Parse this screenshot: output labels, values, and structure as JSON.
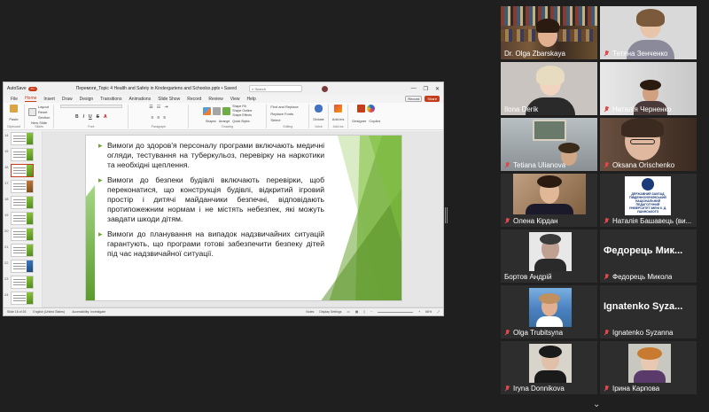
{
  "powerpoint": {
    "autosave_label": "AutoSave",
    "autosave_state": "On",
    "doc_title": "Перемоги_Topic 4 Health and Safety in Kindergartens and Schoolsх.pptx • Saved",
    "search_placeholder": "Search",
    "window_buttons": [
      "—",
      "❐",
      "✕"
    ],
    "menu": [
      "File",
      "Home",
      "Insert",
      "Draw",
      "Design",
      "Transitions",
      "Animations",
      "Slide Show",
      "Record",
      "Review",
      "View",
      "Help"
    ],
    "active_menu": "Home",
    "record_label": "Record",
    "share_label": "Share",
    "ribbon_groups": [
      {
        "name": "Clipboard",
        "label": "Paste"
      },
      {
        "name": "Slides",
        "label": "New Slide"
      },
      {
        "name": "Font",
        "label": ""
      },
      {
        "name": "Paragraph",
        "label": ""
      },
      {
        "name": "Drawing",
        "label": "Shapes"
      },
      {
        "name": "Editing",
        "label": "Find and Replace"
      },
      {
        "name": "Voice",
        "label": "Dictate"
      },
      {
        "name": "Add-ins",
        "label": "Add-ins"
      },
      {
        "name": "",
        "label": "Designer"
      },
      {
        "name": "",
        "label": "Copilot"
      }
    ],
    "ribbon_small": {
      "layout": "Layout",
      "reset": "Reset",
      "section": "Section",
      "replace": "Replace Fonts",
      "select": "Select",
      "shape_fill": "Shape Fill",
      "shape_outline": "Shape Outline",
      "shape_effects": "Shape Effects",
      "arrange": "Arrange",
      "quick_styles": "Quick Styles"
    },
    "thumb_numbers": [
      "14",
      "15",
      "16",
      "17",
      "18",
      "19",
      "20",
      "21",
      "22",
      "23",
      "24"
    ],
    "slide_bullets": [
      "Вимоги до здоров'я персоналу програми включають медичні огляди, тестування на туберкульоз, перевірку на наркотики та необхідні щеплення.",
      "Вимоги до безпеки будівлі включають перевірки, щоб переконатися, що конструкція будівлі, відкритий ігровий простір і дитячі майданчики безпечні, відповідають протипожежним нормам і не містять небезпек, які можуть завдати шкоди дітям.",
      "Вимоги до планування на випадок надзвичайних ситуацій гарантують, що програми готові забезпечити безпеку дітей під час надзвичайної ситуації."
    ],
    "notes_placeholder": "Click to add notes",
    "status": {
      "slide": "Slide 16 of 26",
      "language": "English (United States)",
      "accessibility": "Accessibility: Investigate",
      "notes": "Notes",
      "display": "Display Settings",
      "zoom": "66%"
    }
  },
  "participants": [
    {
      "name": "Dr. Olga Zbarskaya",
      "muted": false,
      "speaking": true
    },
    {
      "name": "Тетяна Зенченко",
      "muted": true
    },
    {
      "name": "Ilona Derik",
      "muted": false
    },
    {
      "name": "Наталія Черненко",
      "muted": true
    },
    {
      "name": "Tetiana Ulianova",
      "muted": true
    },
    {
      "name": "Oksana Orischenko",
      "muted": true
    },
    {
      "name": "Олена Кірдан",
      "muted": true
    },
    {
      "name": "Наталія Башавець (ви...",
      "muted": true
    },
    {
      "name": "Бортов Андрій",
      "muted": false
    },
    {
      "name": "Федорець Микола",
      "muted": true,
      "placeholder": "Федорець Мик..."
    },
    {
      "name": "Olga Trubitsyna",
      "muted": true
    },
    {
      "name": "Ignatenko Syzanna",
      "muted": true,
      "placeholder": "Ignatenko Syza..."
    },
    {
      "name": "Iryna Donnikova",
      "muted": true
    },
    {
      "name": "Ірина Карпова",
      "muted": true
    }
  ],
  "logo_text": "ДЕРЖАВНИЙ ЗАКЛАД ПІВДЕННОУКРАЇНСЬКИЙ НАЦІОНАЛЬНИЙ ПЕДАГОГІЧНИЙ УНІВЕРСИТЕТ ІМЕНІ К. Д. УШИНСЬКОГО",
  "colors": {
    "accent_ppt": "#c43e1c",
    "speaking_outline": "#2fd07a",
    "mic_muted": "#e04848",
    "slide_green": "#6aa533"
  },
  "icons": {
    "mic_off": "mic-off-icon",
    "chevron": "chevron-down-icon"
  }
}
